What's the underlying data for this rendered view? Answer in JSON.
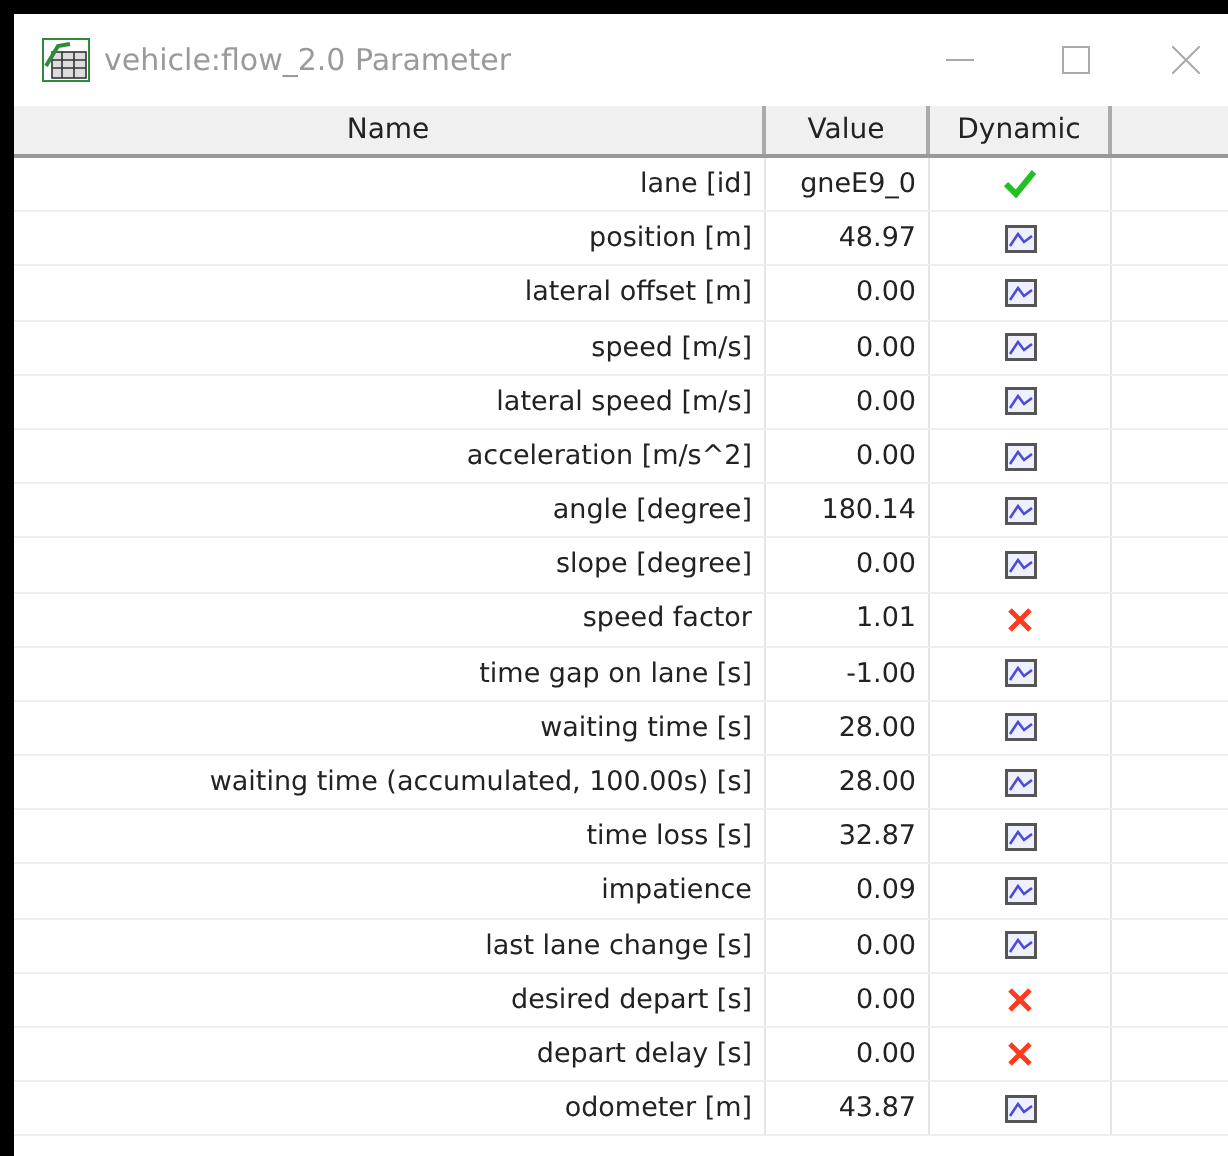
{
  "window": {
    "title": "vehicle:flow_2.0 Parameter"
  },
  "table": {
    "columns": [
      "Name",
      "Value",
      "Dynamic"
    ],
    "rows": [
      {
        "name": "lane [id]",
        "value": "gneE9_0",
        "kind": "check"
      },
      {
        "name": "position [m]",
        "value": "48.97",
        "kind": "plot"
      },
      {
        "name": "lateral offset [m]",
        "value": "0.00",
        "kind": "plot"
      },
      {
        "name": "speed [m/s]",
        "value": "0.00",
        "kind": "plot"
      },
      {
        "name": "lateral speed [m/s]",
        "value": "0.00",
        "kind": "plot"
      },
      {
        "name": "acceleration [m/s^2]",
        "value": "0.00",
        "kind": "plot"
      },
      {
        "name": "angle [degree]",
        "value": "180.14",
        "kind": "plot"
      },
      {
        "name": "slope [degree]",
        "value": "0.00",
        "kind": "plot"
      },
      {
        "name": "speed factor",
        "value": "1.01",
        "kind": "cross"
      },
      {
        "name": "time gap on lane [s]",
        "value": "-1.00",
        "kind": "plot"
      },
      {
        "name": "waiting time [s]",
        "value": "28.00",
        "kind": "plot"
      },
      {
        "name": "waiting time (accumulated, 100.00s) [s]",
        "value": "28.00",
        "kind": "plot"
      },
      {
        "name": "time loss [s]",
        "value": "32.87",
        "kind": "plot"
      },
      {
        "name": "impatience",
        "value": "0.09",
        "kind": "plot"
      },
      {
        "name": "last lane change [s]",
        "value": "0.00",
        "kind": "plot"
      },
      {
        "name": "desired depart [s]",
        "value": "0.00",
        "kind": "cross"
      },
      {
        "name": "depart delay [s]",
        "value": "0.00",
        "kind": "cross"
      },
      {
        "name": "odometer [m]",
        "value": "43.87",
        "kind": "plot"
      }
    ]
  }
}
